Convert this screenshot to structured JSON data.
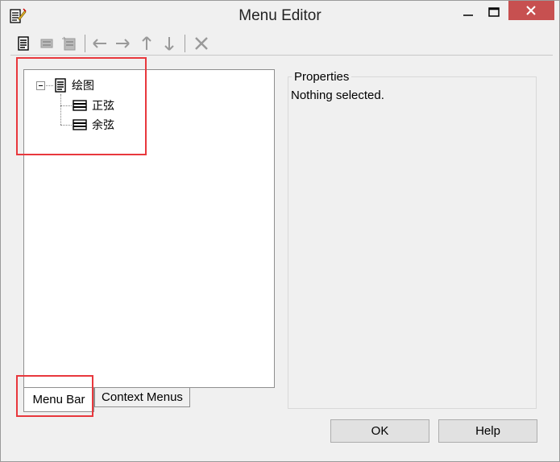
{
  "window": {
    "title": "Menu Editor"
  },
  "toolbar": {
    "icons": [
      "new-menu-icon",
      "new-item-icon",
      "new-separator-icon",
      "move-left-icon",
      "move-right-icon",
      "move-up-icon",
      "move-down-icon",
      "delete-icon"
    ]
  },
  "tree": {
    "root": {
      "label": "绘图",
      "icon": "menu-icon"
    },
    "children": [
      {
        "label": "正弦",
        "icon": "menu-item-icon"
      },
      {
        "label": "余弦",
        "icon": "menu-item-icon"
      }
    ]
  },
  "tabs": [
    {
      "label": "Menu Bar",
      "selected": true
    },
    {
      "label": "Context Menus",
      "selected": false
    }
  ],
  "properties": {
    "title": "Properties",
    "text": "Nothing selected."
  },
  "buttons": {
    "ok": "OK",
    "help": "Help"
  },
  "colors": {
    "highlight": "#e8383d",
    "close_button": "#c75050"
  }
}
